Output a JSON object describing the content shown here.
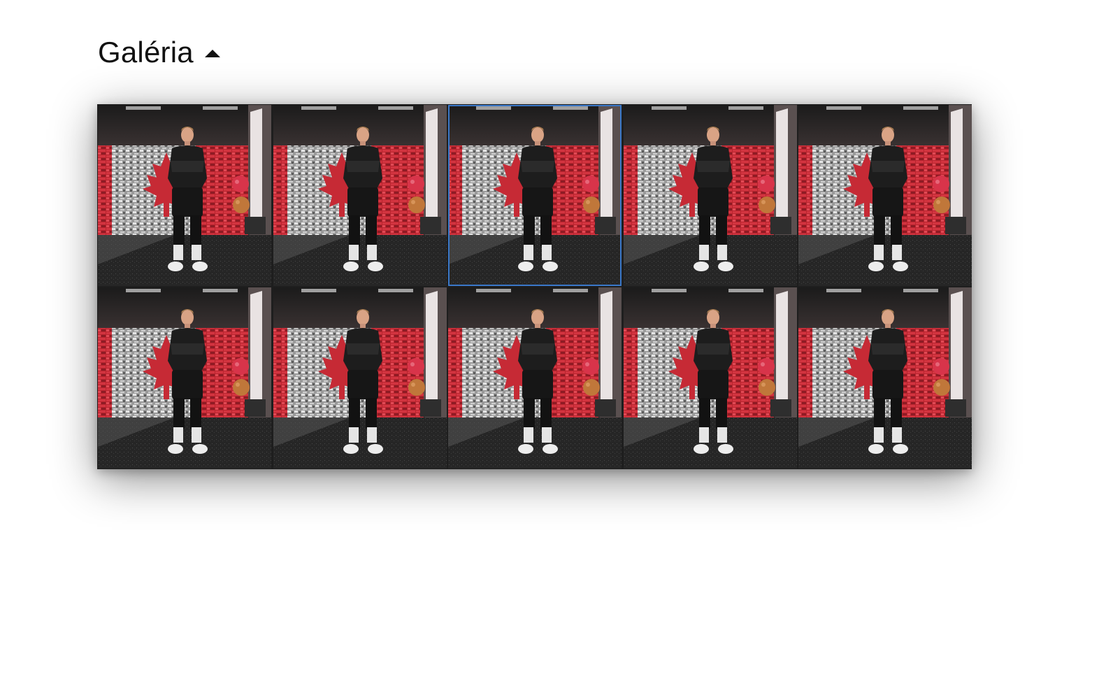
{
  "gallery": {
    "title": "Galéria",
    "toggle_icon": "caret-up-icon",
    "selected_index": 2,
    "thumbnails": [
      {
        "alt": "athlete-photo"
      },
      {
        "alt": "athlete-photo"
      },
      {
        "alt": "athlete-photo"
      },
      {
        "alt": "athlete-photo"
      },
      {
        "alt": "athlete-photo"
      },
      {
        "alt": "athlete-photo"
      },
      {
        "alt": "athlete-photo"
      },
      {
        "alt": "athlete-photo"
      },
      {
        "alt": "athlete-photo"
      },
      {
        "alt": "athlete-photo"
      }
    ]
  },
  "colors": {
    "accent": "#3a78c9",
    "flag_red": "#c62a35",
    "floor": "#2a2a2a"
  }
}
